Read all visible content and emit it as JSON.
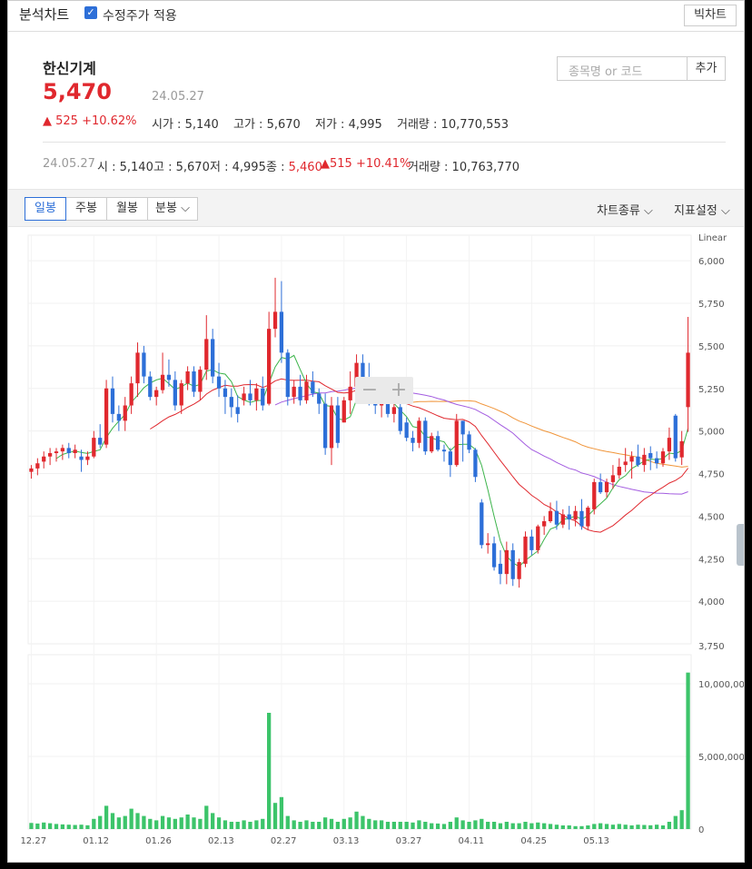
{
  "topbar": {
    "title": "분석차트",
    "adjusted_label": "수정주가 적용",
    "adjusted_checked": true,
    "big_chart_button": "빅차트"
  },
  "stock": {
    "name": "한신기계",
    "price": "5,470",
    "date": "24.05.27",
    "change": "▲ 525 +10.62%",
    "open_label": "시가",
    "open": "5,140",
    "high_label": "고가",
    "high": "5,670",
    "low_label": "저가",
    "low": "4,995",
    "volume_label": "거래량",
    "volume": "10,770,553"
  },
  "search": {
    "placeholder": "종목명 or 코드",
    "add_button": "추가"
  },
  "summary": {
    "date": "24.05.27",
    "open_label": "시",
    "open": "5,140",
    "high_label": "고",
    "high": "5,670",
    "low_label": "저",
    "low": "4,995",
    "close_label": "종",
    "close": "5,460",
    "change": "▲515 +10.41%",
    "volume_label": "거래량",
    "volume": "10,763,770"
  },
  "tabs": [
    {
      "label": "일봉",
      "active": true
    },
    {
      "label": "주봉",
      "active": false
    },
    {
      "label": "월봉",
      "active": false
    },
    {
      "label": "분봉 ⌵",
      "active": false
    }
  ],
  "menus": {
    "chart_type": "차트종류 ⌵",
    "indicator": "지표설정 ⌵"
  },
  "colors": {
    "up": "#e0282e",
    "down": "#2d6fd8",
    "ma5": "#3cb44b",
    "ma20": "#e0282e",
    "ma60": "#a35ce0",
    "ma120": "#f0953a",
    "volume": "#3cc46a"
  },
  "chart_data": {
    "type": "candlestick",
    "scale_label": "Linear",
    "price_ticks": [
      4000,
      4250,
      4500,
      4750,
      5000,
      5250,
      5500,
      5750,
      6000
    ],
    "price_tick_labels": [
      "4,000",
      "4,250",
      "4,500",
      "4,750",
      "5,000",
      "5,250",
      "5,500",
      "5,750",
      "6,000"
    ],
    "axis_min_label": "3,750",
    "ylim": [
      3750,
      6150
    ],
    "volume_ticks": [
      0,
      5000000,
      10000000
    ],
    "volume_tick_labels": [
      "0",
      "5,000,000",
      "10,000,000"
    ],
    "volume_ylim": [
      0,
      12000000
    ],
    "x_labels": [
      {
        "i": 0,
        "label": "12.27"
      },
      {
        "i": 10,
        "label": "01.12"
      },
      {
        "i": 20,
        "label": "01.26"
      },
      {
        "i": 30,
        "label": "02.13"
      },
      {
        "i": 40,
        "label": "02.27"
      },
      {
        "i": 50,
        "label": "03.13"
      },
      {
        "i": 60,
        "label": "03.27"
      },
      {
        "i": 70,
        "label": "04.11"
      },
      {
        "i": 80,
        "label": "04.25"
      },
      {
        "i": 90,
        "label": "05.13"
      }
    ],
    "candles": [
      [
        4760,
        4800,
        4720,
        4780,
        420000
      ],
      [
        4780,
        4840,
        4740,
        4810,
        380000
      ],
      [
        4820,
        4880,
        4780,
        4850,
        450000
      ],
      [
        4850,
        4900,
        4800,
        4870,
        400000
      ],
      [
        4870,
        4900,
        4820,
        4880,
        350000
      ],
      [
        4880,
        4920,
        4830,
        4900,
        320000
      ],
      [
        4900,
        4930,
        4840,
        4870,
        300000
      ],
      [
        4870,
        4920,
        4840,
        4890,
        280000
      ],
      [
        4850,
        4890,
        4760,
        4830,
        300000
      ],
      [
        4830,
        4880,
        4800,
        4850,
        260000
      ],
      [
        4850,
        5000,
        4840,
        4960,
        700000
      ],
      [
        4960,
        5040,
        4900,
        4920,
        900000
      ],
      [
        4920,
        5300,
        4900,
        5250,
        1600000
      ],
      [
        5250,
        5320,
        5050,
        5100,
        1100000
      ],
      [
        5100,
        5150,
        5000,
        5060,
        800000
      ],
      [
        5060,
        5200,
        5000,
        5150,
        900000
      ],
      [
        5150,
        5320,
        5100,
        5280,
        1400000
      ],
      [
        5280,
        5520,
        5200,
        5460,
        1100000
      ],
      [
        5460,
        5500,
        5280,
        5320,
        900000
      ],
      [
        5320,
        5350,
        5180,
        5200,
        700000
      ],
      [
        5200,
        5260,
        5150,
        5240,
        600000
      ],
      [
        5240,
        5460,
        5220,
        5330,
        900000
      ],
      [
        5330,
        5420,
        5260,
        5300,
        800000
      ],
      [
        5300,
        5350,
        5120,
        5150,
        700000
      ],
      [
        5150,
        5300,
        5100,
        5280,
        800000
      ],
      [
        5280,
        5380,
        5240,
        5350,
        1000000
      ],
      [
        5350,
        5380,
        5200,
        5230,
        800000
      ],
      [
        5230,
        5380,
        5180,
        5360,
        700000
      ],
      [
        5360,
        5680,
        5300,
        5540,
        1600000
      ],
      [
        5540,
        5600,
        5280,
        5320,
        1100000
      ],
      [
        5320,
        5400,
        5200,
        5250,
        800000
      ],
      [
        5250,
        5300,
        5100,
        5200,
        600000
      ],
      [
        5200,
        5250,
        5080,
        5140,
        500000
      ],
      [
        5140,
        5210,
        5050,
        5100,
        500000
      ],
      [
        5180,
        5260,
        5150,
        5220,
        600000
      ],
      [
        5220,
        5300,
        5150,
        5180,
        500000
      ],
      [
        5180,
        5280,
        5120,
        5250,
        600000
      ],
      [
        5250,
        5320,
        5120,
        5150,
        700000
      ],
      [
        5160,
        5700,
        5150,
        5600,
        8000000
      ],
      [
        5600,
        5900,
        5550,
        5700,
        1800000
      ],
      [
        5700,
        5880,
        5400,
        5460,
        2200000
      ],
      [
        5460,
        5480,
        5150,
        5200,
        900000
      ],
      [
        5200,
        5300,
        5160,
        5260,
        600000
      ],
      [
        5260,
        5330,
        5150,
        5180,
        500000
      ],
      [
        5180,
        5330,
        5160,
        5290,
        600000
      ],
      [
        5290,
        5350,
        5200,
        5220,
        500000
      ],
      [
        5220,
        5250,
        5100,
        5160,
        500000
      ],
      [
        5160,
        5220,
        4860,
        4900,
        800000
      ],
      [
        4900,
        5200,
        4800,
        5150,
        700000
      ],
      [
        5150,
        5200,
        4900,
        4930,
        500000
      ],
      [
        5050,
        5200,
        5050,
        5180,
        700000
      ],
      [
        5180,
        5350,
        5100,
        5260,
        800000
      ],
      [
        5260,
        5450,
        5230,
        5400,
        1200000
      ],
      [
        5400,
        5450,
        5250,
        5300,
        900000
      ],
      [
        5300,
        5400,
        5150,
        5200,
        700000
      ],
      [
        5200,
        5300,
        5100,
        5150,
        600000
      ],
      [
        5150,
        5250,
        5080,
        5220,
        600000
      ],
      [
        5220,
        5250,
        5080,
        5100,
        500000
      ],
      [
        5100,
        5230,
        5050,
        5140,
        500000
      ],
      [
        5140,
        5180,
        4980,
        5000,
        500000
      ],
      [
        5050,
        5080,
        4940,
        4960,
        500000
      ],
      [
        4960,
        5000,
        4880,
        4930,
        450000
      ],
      [
        4930,
        5080,
        4900,
        5060,
        600000
      ],
      [
        5060,
        5080,
        4860,
        4880,
        500000
      ],
      [
        4880,
        4990,
        4870,
        4970,
        400000
      ],
      [
        4970,
        5000,
        4880,
        4890,
        380000
      ],
      [
        4890,
        4920,
        4820,
        4880,
        350000
      ],
      [
        4880,
        4900,
        4730,
        4800,
        500000
      ],
      [
        4800,
        5100,
        4790,
        5060,
        800000
      ],
      [
        5060,
        5060,
        4820,
        4980,
        600000
      ],
      [
        4980,
        5000,
        4870,
        4890,
        500000
      ],
      [
        4890,
        4900,
        4700,
        4730,
        600000
      ],
      [
        4580,
        4600,
        4310,
        4330,
        700000
      ],
      [
        4330,
        4400,
        4280,
        4340,
        500000
      ],
      [
        4340,
        4380,
        4180,
        4200,
        500000
      ],
      [
        4220,
        4300,
        4100,
        4160,
        400000
      ],
      [
        4160,
        4350,
        4100,
        4300,
        500000
      ],
      [
        4300,
        4340,
        4090,
        4130,
        400000
      ],
      [
        4130,
        4250,
        4080,
        4230,
        400000
      ],
      [
        4220,
        4410,
        4200,
        4380,
        500000
      ],
      [
        4380,
        4420,
        4270,
        4300,
        400000
      ],
      [
        4300,
        4450,
        4280,
        4440,
        450000
      ],
      [
        4440,
        4500,
        4390,
        4470,
        400000
      ],
      [
        4470,
        4580,
        4460,
        4530,
        350000
      ],
      [
        4530,
        4590,
        4420,
        4450,
        300000
      ],
      [
        4450,
        4540,
        4430,
        4510,
        250000
      ],
      [
        4510,
        4560,
        4420,
        4480,
        250000
      ],
      [
        4480,
        4560,
        4440,
        4530,
        200000
      ],
      [
        4530,
        4600,
        4420,
        4440,
        200000
      ],
      [
        4440,
        4560,
        4420,
        4550,
        250000
      ],
      [
        4540,
        4720,
        4510,
        4700,
        350000
      ],
      [
        4700,
        4750,
        4630,
        4640,
        400000
      ],
      [
        4640,
        4720,
        4610,
        4700,
        350000
      ],
      [
        4700,
        4800,
        4660,
        4740,
        300000
      ],
      [
        4740,
        4840,
        4720,
        4790,
        350000
      ],
      [
        4800,
        4900,
        4760,
        4820,
        300000
      ],
      [
        4820,
        4880,
        4720,
        4850,
        250000
      ],
      [
        4850,
        4920,
        4790,
        4800,
        300000
      ],
      [
        4800,
        4900,
        4760,
        4860,
        280000
      ],
      [
        4870,
        4910,
        4770,
        4840,
        260000
      ],
      [
        4840,
        4880,
        4780,
        4810,
        300000
      ],
      [
        4810,
        4900,
        4790,
        4880,
        250000
      ],
      [
        4880,
        5020,
        4830,
        4960,
        500000
      ],
      [
        5090,
        5100,
        4820,
        4840,
        900000
      ],
      [
        4845,
        5000,
        4800,
        4940,
        1300000
      ],
      [
        5140,
        5670,
        4995,
        5460,
        10770553
      ]
    ]
  }
}
